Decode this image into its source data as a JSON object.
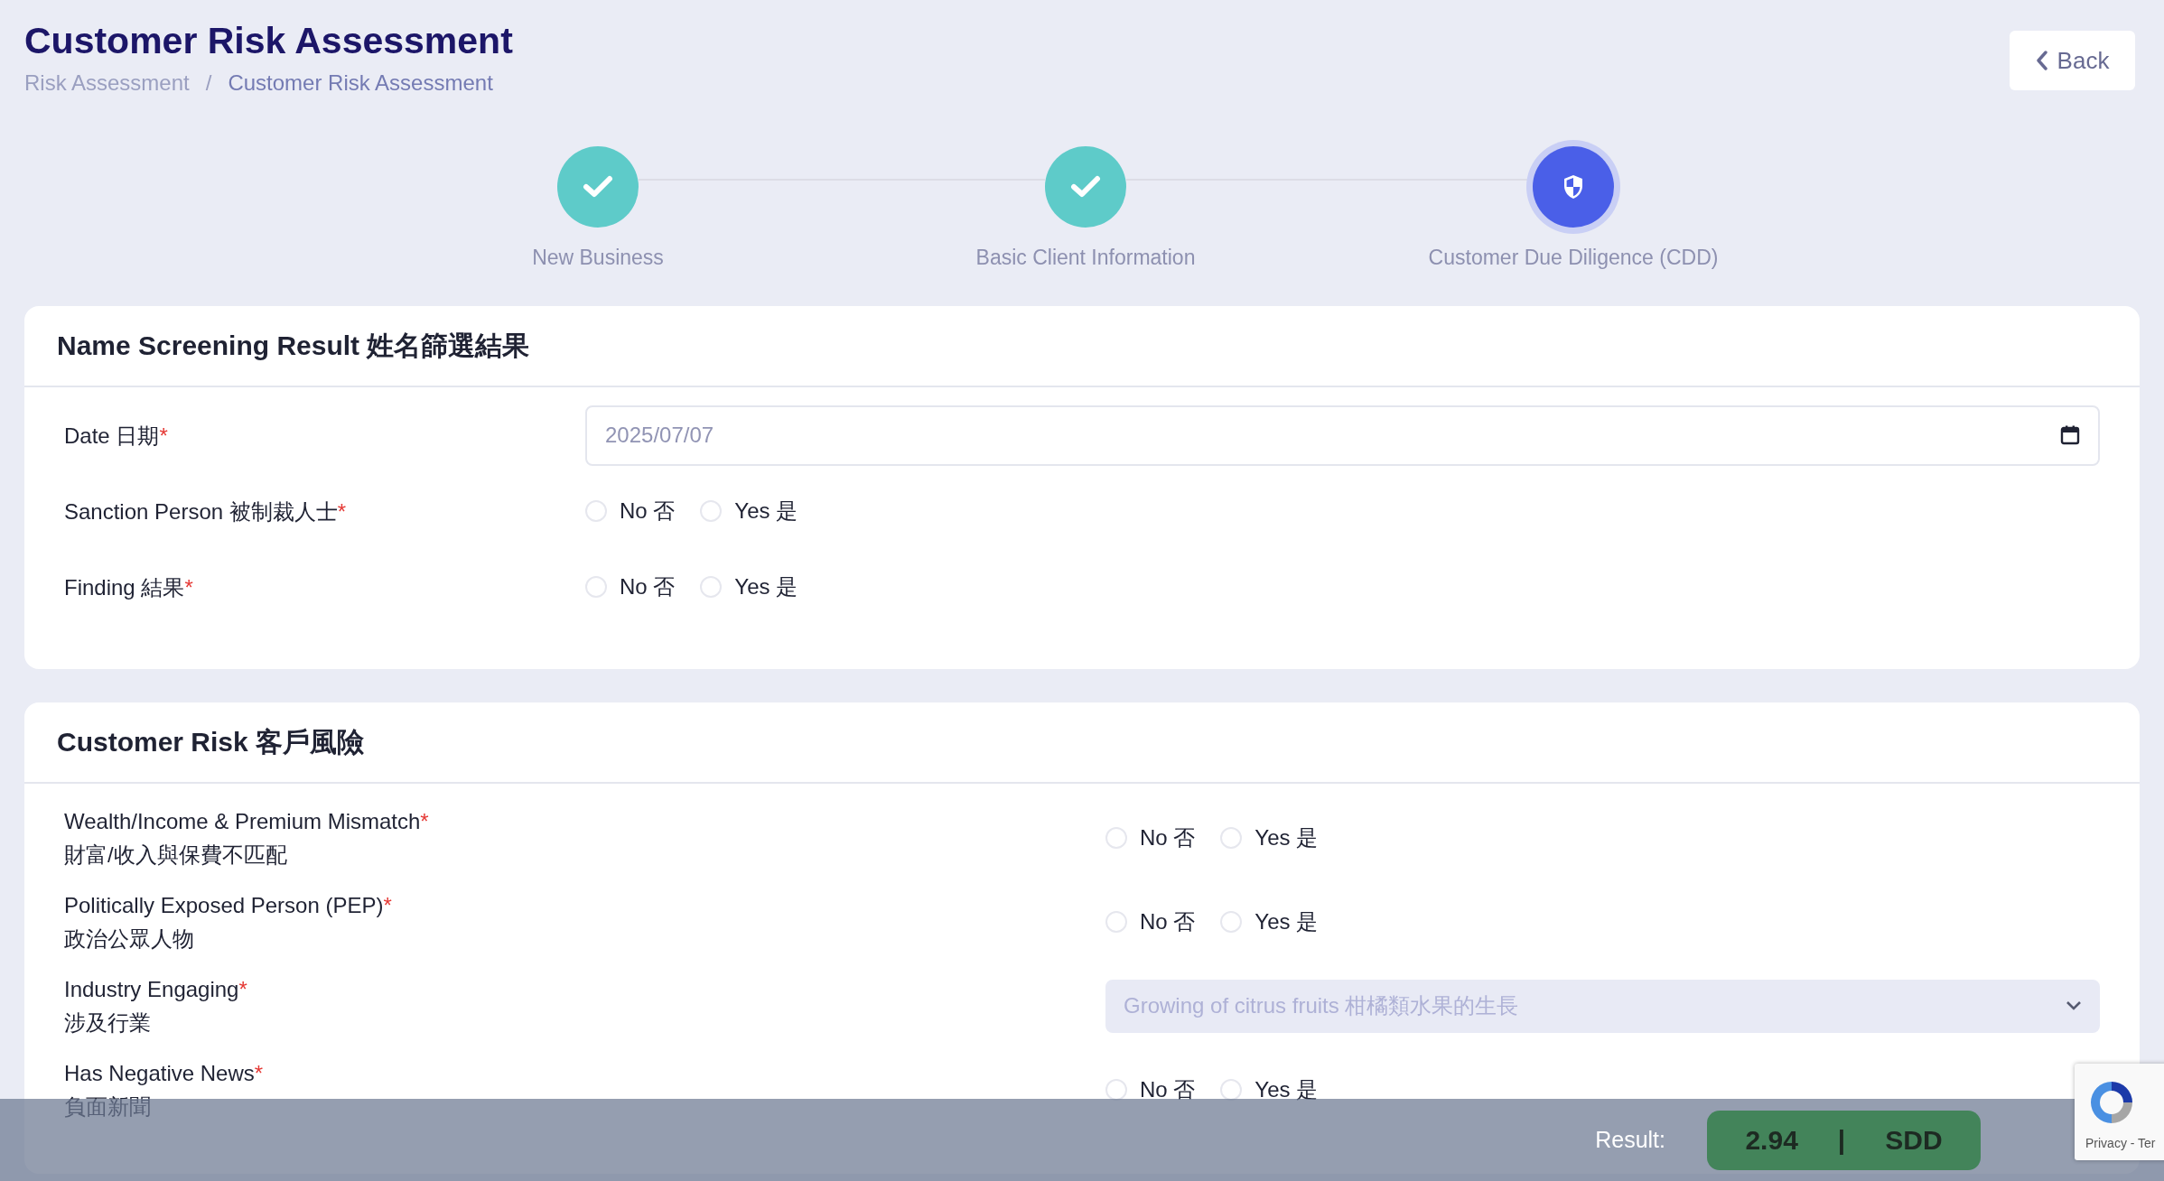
{
  "header": {
    "title": "Customer Risk Assessment",
    "breadcrumb": [
      {
        "label": "Risk Assessment",
        "selected": false
      },
      {
        "label": "Customer Risk Assessment",
        "selected": true
      }
    ],
    "separator": "/"
  },
  "back_button": {
    "label": "Back"
  },
  "steps": [
    {
      "label": "New Business",
      "completed": true
    },
    {
      "label": "Basic Client Information",
      "completed": true
    },
    {
      "label": "Customer Due Diligence (CDD)",
      "completed": false
    }
  ],
  "sections": [
    {
      "title": "Name Screening Result 姓名篩選結果",
      "fields": [
        {
          "kind": "date",
          "label": "Date 日期",
          "required_mark": "*",
          "value": "2025/07/07"
        },
        {
          "kind": "radio",
          "label": "Sanction Person 被制裁人士",
          "required_mark": "*",
          "options": [
            {
              "label": "No 否",
              "selected": false
            },
            {
              "label": "Yes 是",
              "selected": false
            }
          ]
        },
        {
          "kind": "radio",
          "label": "Finding 結果",
          "required_mark": "*",
          "options": [
            {
              "label": "No 否",
              "selected": false
            },
            {
              "label": "Yes 是",
              "selected": false
            }
          ]
        }
      ]
    },
    {
      "title": "Customer Risk 客戶風險",
      "fields": [
        {
          "kind": "radio",
          "label": "Wealth/Income & Premium Mismatch",
          "required_mark": "*",
          "sublabel": "財富/收入與保費不匹配",
          "options": [
            {
              "label": "No 否",
              "selected": false
            },
            {
              "label": "Yes 是",
              "selected": false
            }
          ]
        },
        {
          "kind": "radio",
          "label": "Politically Exposed Person (PEP)",
          "required_mark": "*",
          "sublabel": "政治公眾人物",
          "options": [
            {
              "label": "No 否",
              "selected": false
            },
            {
              "label": "Yes 是",
              "selected": false
            }
          ]
        },
        {
          "kind": "select",
          "label": "Industry Engaging",
          "required_mark": "*",
          "sublabel": "涉及行業",
          "value": "Growing of citrus fruits 柑橘類水果的生長",
          "disabled": true
        },
        {
          "kind": "radio",
          "label": "Has Negative News",
          "required_mark": "*",
          "sublabel": "負面新聞",
          "options": [
            {
              "label": "No 否",
              "selected": false
            },
            {
              "label": "Yes 是",
              "selected": false
            }
          ]
        }
      ]
    }
  ],
  "result_bar": {
    "label": "Result:",
    "score": "2.94",
    "divider": "|",
    "grade": "SDD"
  },
  "recaptcha": {
    "text": "Privacy - Ter"
  }
}
